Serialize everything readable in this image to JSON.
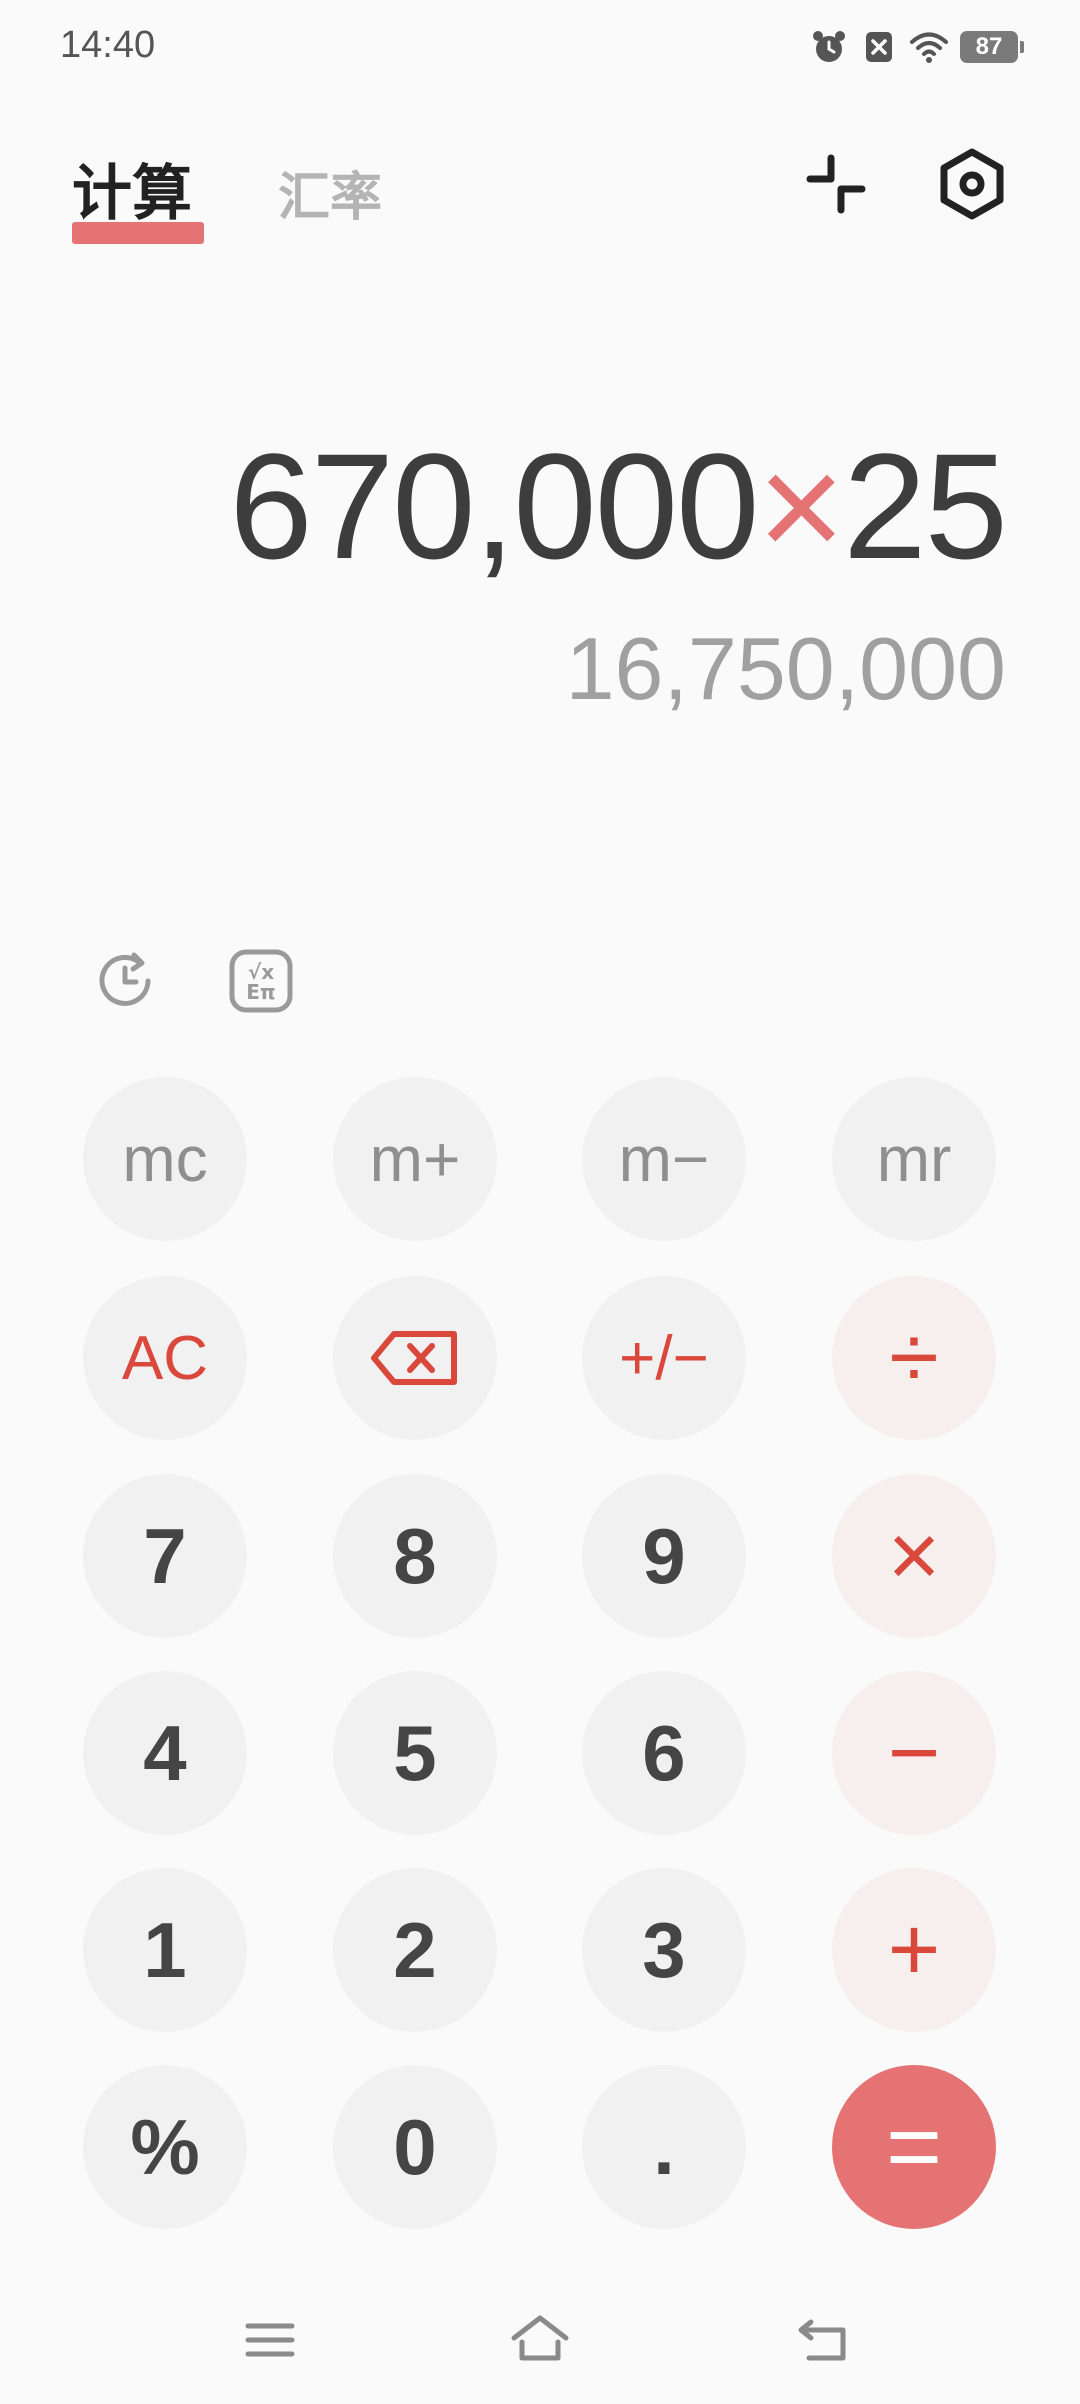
{
  "status": {
    "time": "14:40",
    "battery": "87"
  },
  "tabs": {
    "active": "计算",
    "inactive": "汇率"
  },
  "display": {
    "operand1": "670,000",
    "operator": "×",
    "operand2": "25",
    "result": "16,750,000"
  },
  "keys": {
    "mc": "mc",
    "mplus": "m+",
    "mminus": "m−",
    "mr": "mr",
    "ac": "AC",
    "sign": "+/−",
    "divide": "÷",
    "multiply": "×",
    "minus": "−",
    "plus": "+",
    "equals": "=",
    "n7": "7",
    "n8": "8",
    "n9": "9",
    "n4": "4",
    "n5": "5",
    "n6": "6",
    "n1": "1",
    "n2": "2",
    "n3": "3",
    "percent": "%",
    "n0": "0",
    "dot": "."
  },
  "colors": {
    "accent": "#e57373",
    "operator_text": "#d9483b",
    "key_bg": "#f1f1f1",
    "op_key_bg": "#f7eeee"
  },
  "icons": [
    "alarm-icon",
    "notification-icon",
    "wifi-icon",
    "battery-icon",
    "collapse-icon",
    "settings-icon",
    "history-icon",
    "scientific-icon",
    "backspace-icon",
    "menu-nav-icon",
    "home-nav-icon",
    "back-nav-icon"
  ]
}
